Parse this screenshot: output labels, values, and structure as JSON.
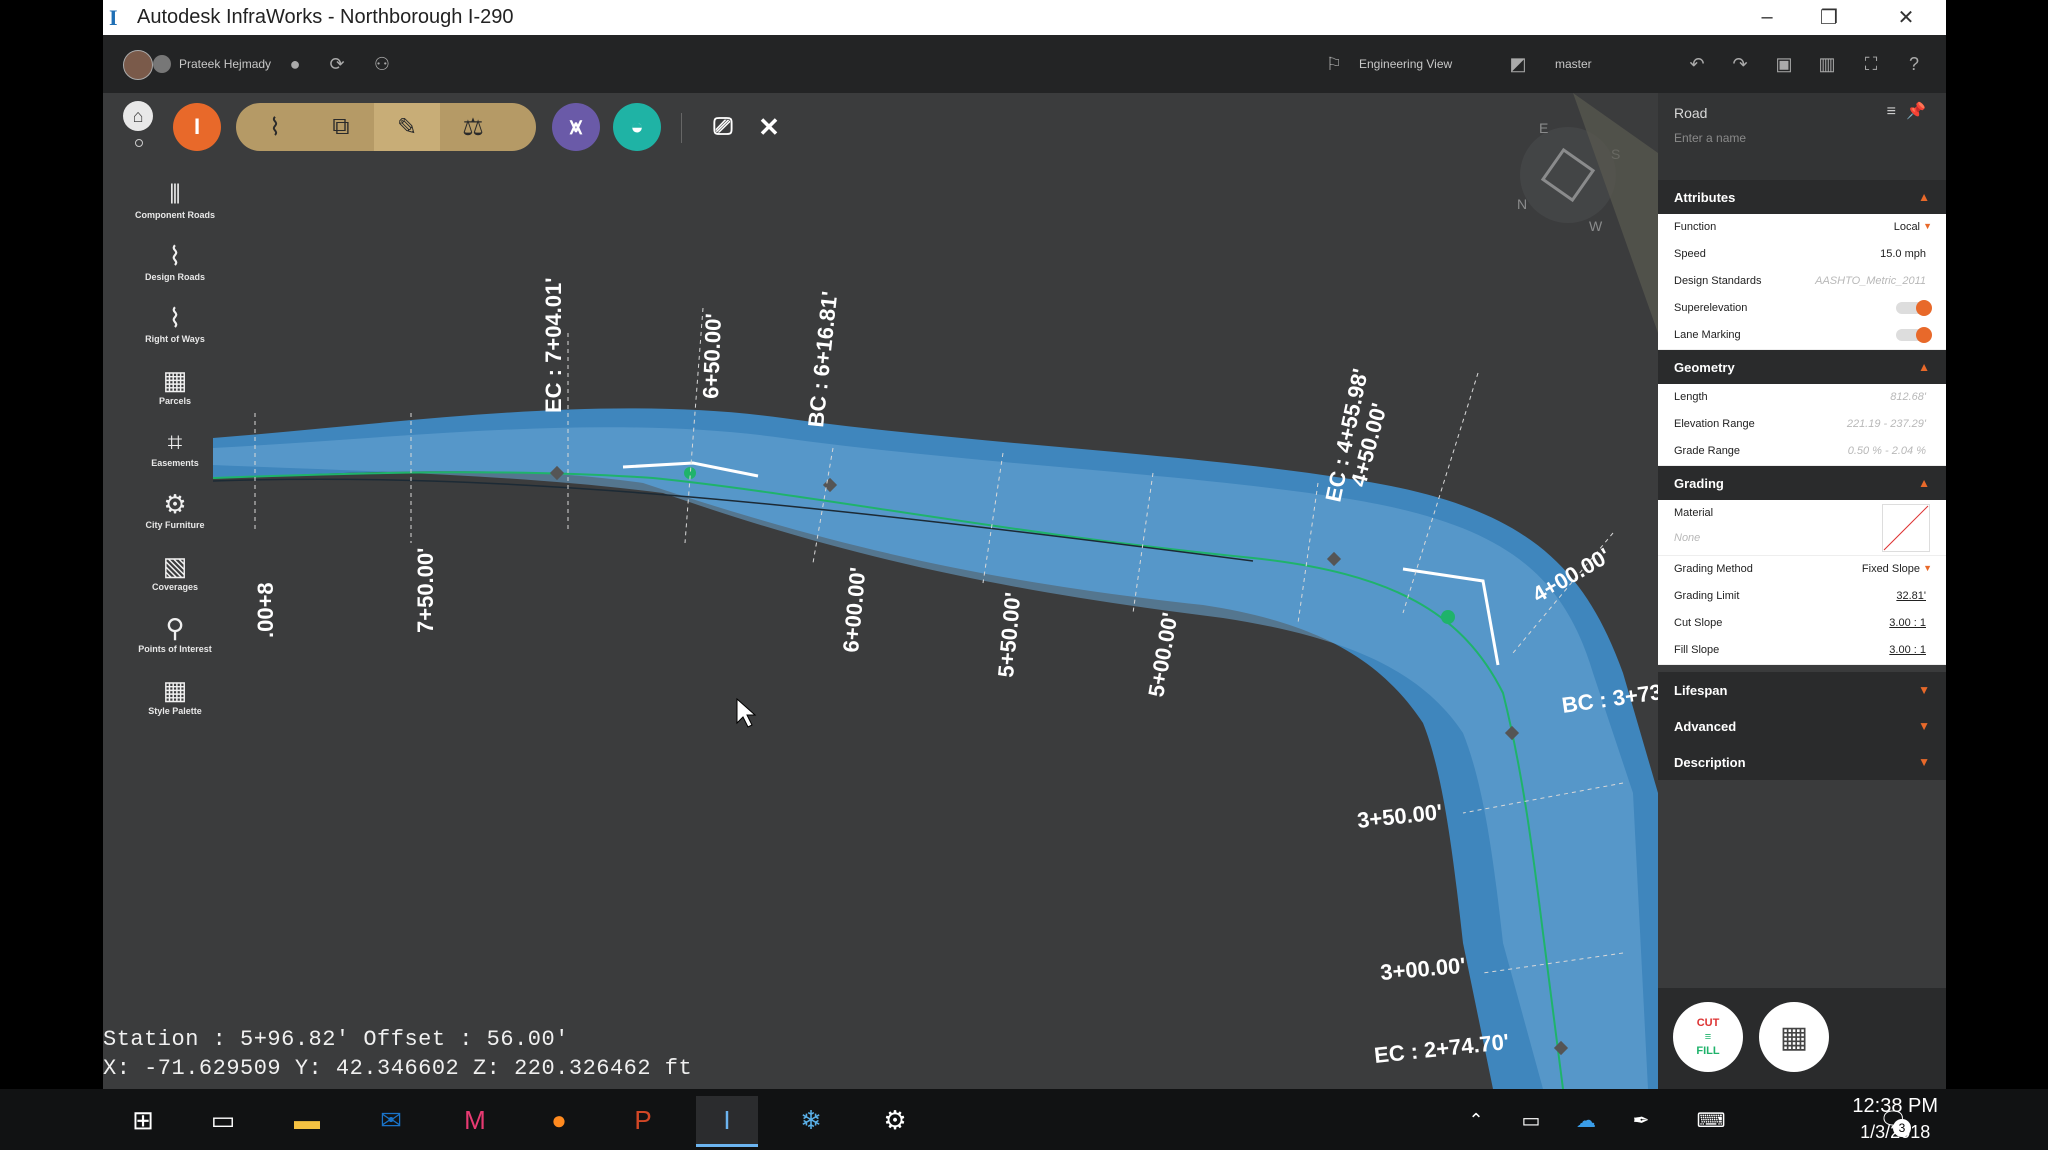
{
  "window": {
    "title": "Autodesk InfraWorks - Northborough I-290",
    "app_icon": "I",
    "controls": {
      "minimize": "–",
      "restore": "❐",
      "close": "✕"
    }
  },
  "topbar": {
    "user_name": "Prateek Hejmady",
    "engineering_view_label": "Engineering View",
    "branch_label": "master"
  },
  "toolbar": {
    "home_label": "⌂",
    "infra_label": "I"
  },
  "left_tools": [
    {
      "label": "Component Roads",
      "icon": "component-roads-icon",
      "glyph": "⫴"
    },
    {
      "label": "Design Roads",
      "icon": "design-roads-icon",
      "glyph": "⌇"
    },
    {
      "label": "Right of Ways",
      "icon": "right-of-ways-icon",
      "glyph": "⌇"
    },
    {
      "label": "Parcels",
      "icon": "parcels-icon",
      "glyph": "▦"
    },
    {
      "label": "Easements",
      "icon": "easements-icon",
      "glyph": "⌗"
    },
    {
      "label": "City Furniture",
      "icon": "city-furniture-icon",
      "glyph": "⚙"
    },
    {
      "label": "Coverages",
      "icon": "coverages-icon",
      "glyph": "▧"
    },
    {
      "label": "Points of Interest",
      "icon": "points-of-interest-icon",
      "glyph": "⚲"
    },
    {
      "label": "Style Palette",
      "icon": "style-palette-icon",
      "glyph": "▦"
    }
  ],
  "compass": {
    "n": "N",
    "e": "E",
    "s": "S",
    "w": "W"
  },
  "map_labels": {
    "ec_700": "EC : 7+04.01'",
    "s650": "6+50.00'",
    "bc_616": "BC : 6+16.81'",
    "s800": ".00+8",
    "s750": "7+50.00'",
    "s600": "6+00.00'",
    "s550": "5+50.00'",
    "s500": "5+00.00'",
    "ec_455": "EC : 4+55.98'",
    "s450": "4+50.00'",
    "s400": "4+00.00'",
    "bc_373": "BC : 3+73",
    "s350": "3+50.00'",
    "s300": "3+00.00'",
    "ec_274": "EC : 2+74.70'"
  },
  "status": {
    "line1": "Station : 5+96.82' Offset : 56.00'",
    "line2": "X: -71.629509 Y: 42.346602 Z: 220.326462 ft"
  },
  "panel": {
    "title": "Road",
    "name_placeholder": "Enter a name",
    "attributes": {
      "header": "Attributes",
      "rows": [
        {
          "k": "Function",
          "v": "Local"
        },
        {
          "k": "Speed",
          "v": "15.0 mph"
        },
        {
          "k": "Design Standards",
          "v": "AASHTO_Metric_2011"
        },
        {
          "k": "Superelevation",
          "v": ""
        },
        {
          "k": "Lane Marking",
          "v": ""
        }
      ]
    },
    "geometry": {
      "header": "Geometry",
      "rows": [
        {
          "k": "Length",
          "v": "812.68'"
        },
        {
          "k": "Elevation Range",
          "v": "221.19 - 237.29'"
        },
        {
          "k": "Grade Range",
          "v": "0.50 % - 2.04 %"
        }
      ]
    },
    "grading": {
      "header": "Grading",
      "material_label": "Material",
      "material_value": "None",
      "rows": [
        {
          "k": "Grading Method",
          "v": "Fixed Slope"
        },
        {
          "k": "Grading Limit",
          "v": "32.81'"
        },
        {
          "k": "Cut Slope",
          "v": "3.00 : 1"
        },
        {
          "k": "Fill Slope",
          "v": "3.00 : 1"
        }
      ]
    },
    "lifespan_header": "Lifespan",
    "advanced_header": "Advanced",
    "description_header": "Description"
  },
  "fab": {
    "cut": "CUT",
    "fill": "FILL"
  },
  "taskbar": {
    "time": "12:38 PM",
    "date": "1/3/2018",
    "notifications": "3"
  },
  "colors": {
    "accent": "#e8692a",
    "road": "#3f86bd",
    "road_light": "#6aa6d3",
    "centerline": "#1fb36b"
  }
}
